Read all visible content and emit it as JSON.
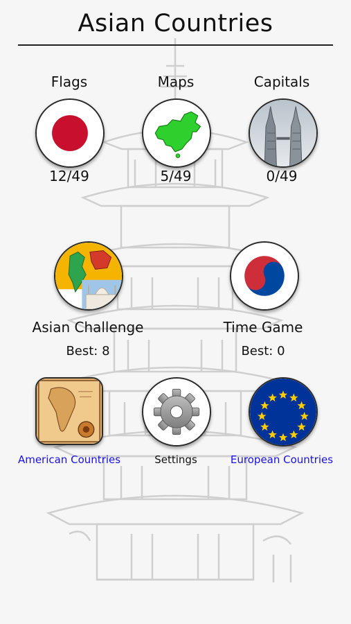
{
  "header": {
    "title": "Asian Countries"
  },
  "categories": [
    {
      "label": "Flags",
      "score": "12/49",
      "icon": "japan-flag-icon"
    },
    {
      "label": "Maps",
      "score": "5/49",
      "icon": "china-map-icon"
    },
    {
      "label": "Capitals",
      "score": "0/49",
      "icon": "petronas-towers-icon"
    }
  ],
  "modes": [
    {
      "label": "Asian Challenge",
      "best": "Best: 8",
      "icon": "challenge-collage-icon"
    },
    {
      "label": "Time Game",
      "best": "Best: 0",
      "icon": "south-korea-flag-icon"
    }
  ],
  "footer": {
    "american": {
      "label": "American Countries",
      "icon": "old-map-icon"
    },
    "settings": {
      "label": "Settings",
      "icon": "gear-icon"
    },
    "european": {
      "label": "European Countries",
      "icon": "eu-flag-icon"
    }
  },
  "colors": {
    "link": "#1a10e8",
    "japan_red": "#c8102e",
    "map_green": "#2ed02e",
    "eu_blue": "#003399",
    "eu_gold": "#ffcc00",
    "korea_red": "#cd2e3a",
    "korea_blue": "#0047a0"
  }
}
